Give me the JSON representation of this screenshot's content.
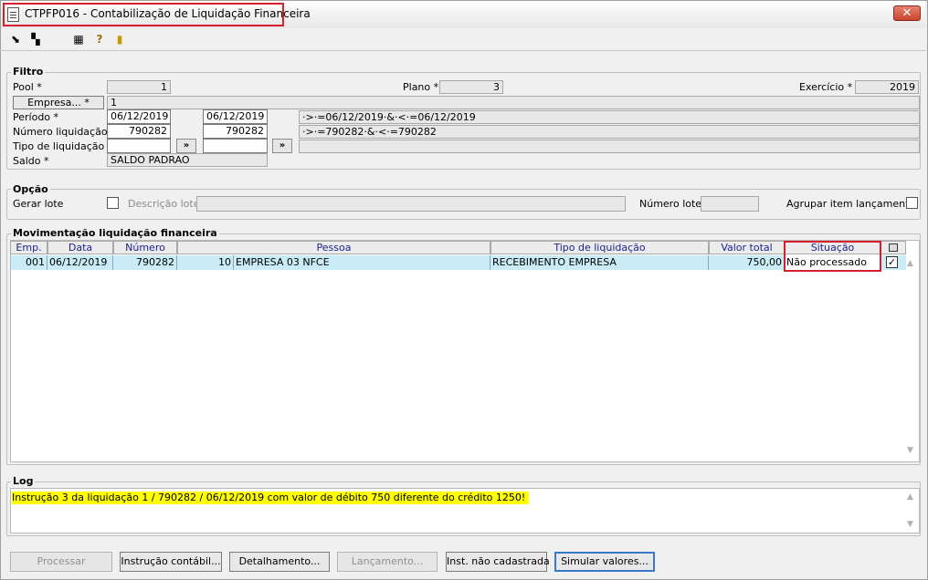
{
  "window": {
    "title": "CTPFP016 - Contabilização de Liquidação Financeira",
    "close_glyph": "✕"
  },
  "filtro": {
    "label": "Filtro",
    "pool_label": "Pool *",
    "pool_value": "1",
    "plano_label": "Plano *",
    "plano_value": "3",
    "exercicio_label": "Exercício *",
    "exercicio_value": "2019",
    "empresa_button": "Empresa... *",
    "empresa_value": "1",
    "periodo_label": "Período *",
    "periodo_from": "06/12/2019",
    "periodo_to": "06/12/2019",
    "periodo_expr": "·>·=06/12/2019·&·<·=06/12/2019",
    "numero_label": "Número liquidação",
    "numero_from": "790282",
    "numero_to": "790282",
    "numero_expr": "·>·=790282·&·<·=790282",
    "tipo_label": "Tipo de liquidação",
    "tipo_from": "",
    "tipo_to": "",
    "tipo_expr": "",
    "more_button": "»",
    "saldo_label": "Saldo *",
    "saldo_value": "SALDO PADRAO"
  },
  "opcao": {
    "label": "Opção",
    "gerar_lote_label": "Gerar lote",
    "descricao_label": "Descrição lote",
    "descricao_value": "",
    "numero_lote_label": "Número lote",
    "numero_lote_value": "",
    "agrupar_label": "Agrupar item lançamento"
  },
  "grid": {
    "label": "Movimentação liquidação financeira",
    "columns": [
      "Emp.",
      "Data",
      "Número",
      "",
      "Pessoa",
      "Tipo de liquidação",
      "Valor total",
      "Situação"
    ],
    "rows": [
      {
        "emp": "001",
        "data": "06/12/2019",
        "numero": "790282",
        "pessoa_cod": "10",
        "pessoa": "EMPRESA 03 NFCE",
        "tipo": "RECEBIMENTO EMPRESA",
        "valor": "750,00",
        "situacao": "Não processado",
        "checked": true
      }
    ]
  },
  "log": {
    "label": "Log",
    "message": "Instrução 3 da liquidação 1 / 790282 / 06/12/2019 com valor de débito 750 diferente do crédito 1250!",
    "highlight_color": "#ffff00"
  },
  "buttons": {
    "processar": "Processar",
    "instrucao": "Instrução contábil...",
    "detalhamento": "Detalhamento...",
    "lancamento": "Lançamento...",
    "inst_nao_cadastrada": "Inst. não cadastrada",
    "simular": "Simular valores..."
  },
  "colors": {
    "highlight_border": "#d4202c",
    "selected_row": "#c9ecf6",
    "header_text": "#1a1f8c"
  }
}
